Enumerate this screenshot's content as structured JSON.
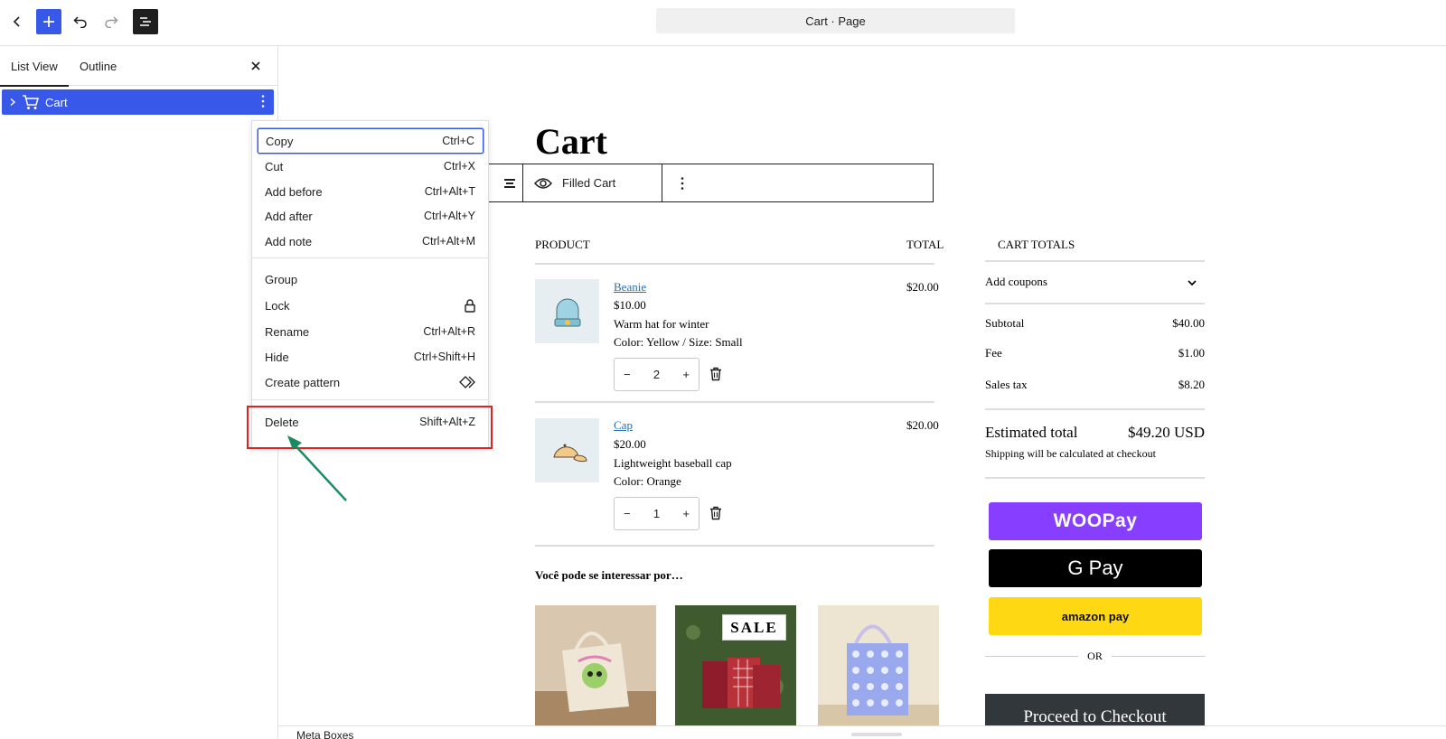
{
  "header": {
    "doc_title": "Cart · Page",
    "accent_color": "#3858e9"
  },
  "sidebar": {
    "tabs": [
      {
        "label": "List View",
        "active": true
      },
      {
        "label": "Outline",
        "active": false
      }
    ],
    "items": [
      {
        "label": "Cart",
        "icon": "cart-icon",
        "selected": true
      }
    ]
  },
  "context_menu": {
    "groups": [
      [
        {
          "label": "Copy",
          "shortcut": "Ctrl+C"
        },
        {
          "label": "Cut",
          "shortcut": "Ctrl+X"
        },
        {
          "label": "Add before",
          "shortcut": "Ctrl+Alt+T"
        },
        {
          "label": "Add after",
          "shortcut": "Ctrl+Alt+Y"
        },
        {
          "label": "Add note",
          "shortcut": "Ctrl+Alt+M"
        }
      ],
      [
        {
          "label": "Group",
          "shortcut": ""
        },
        {
          "label": "Lock",
          "icon": "lock-icon"
        },
        {
          "label": "Rename",
          "shortcut": "Ctrl+Alt+R"
        },
        {
          "label": "Hide",
          "shortcut": "Ctrl+Shift+H"
        },
        {
          "label": "Create pattern",
          "icon": "pattern-icon"
        }
      ],
      [
        {
          "label": "Delete",
          "shortcut": "Shift+Alt+Z"
        }
      ]
    ],
    "highlight_color": "#e02222"
  },
  "canvas": {
    "page_title": "Cart",
    "block_toolbar": {
      "view_label": "Filled Cart"
    },
    "cart": {
      "col_product": "PRODUCT",
      "col_total": "TOTAL",
      "items": [
        {
          "name": "Beanie",
          "price": "$10.00",
          "description": "Warm hat for winter",
          "variation": "Color: Yellow / Size: Small",
          "qty": "2",
          "total": "$20.00"
        },
        {
          "name": "Cap",
          "price": "$20.00",
          "description": "Lightweight baseball cap",
          "variation": "Color: Orange",
          "qty": "1",
          "total": "$20.00"
        }
      ],
      "upsell_heading": "Você pode se interessar por…",
      "upsell_sale": "SALE"
    },
    "totals": {
      "heading": "CART TOTALS",
      "coupons": "Add coupons",
      "subtotal_label": "Subtotal",
      "subtotal": "$40.00",
      "fee_label": "Fee",
      "fee": "$1.00",
      "tax_label": "Sales tax",
      "tax": "$8.20",
      "estimated_label": "Estimated total",
      "estimated": "$49.20 USD",
      "shipping_note": "Shipping will be calculated at checkout",
      "woopay": "WOOPay",
      "gpay": "G Pay",
      "amazonpay": "amazon pay",
      "or": "OR",
      "checkout": "Proceed to Checkout"
    }
  },
  "footer": {
    "meta_boxes": "Meta Boxes"
  }
}
